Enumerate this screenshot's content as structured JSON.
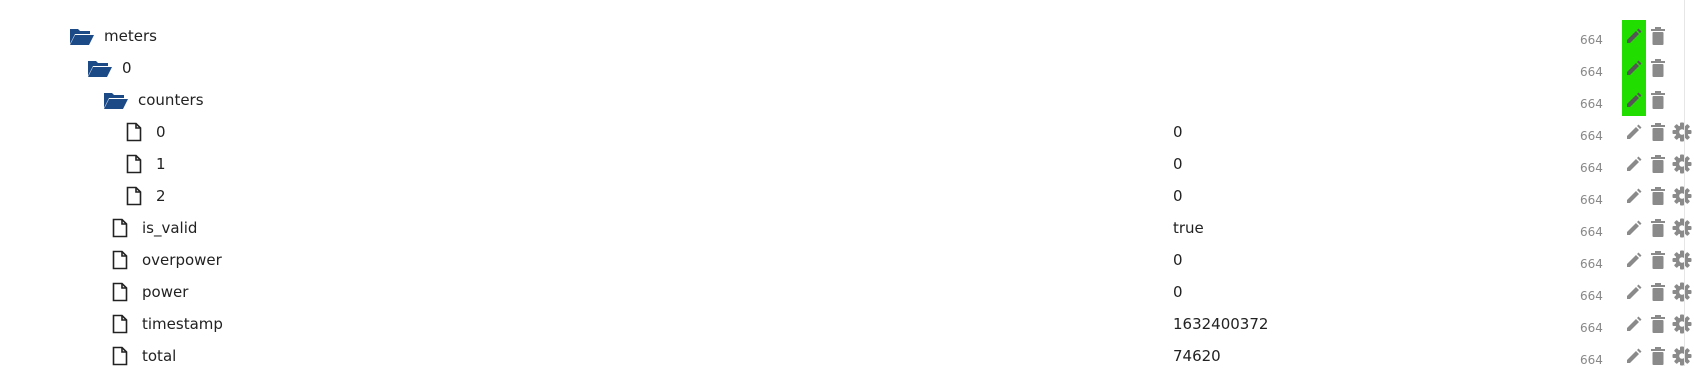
{
  "tree": {
    "rows": [
      {
        "name": "meters",
        "type": "folder",
        "value": "",
        "perm": "664",
        "edit_highlighted": true,
        "has_settings": false
      },
      {
        "name": "0",
        "type": "folder",
        "value": "",
        "perm": "664",
        "edit_highlighted": true,
        "has_settings": false
      },
      {
        "name": "counters",
        "type": "folder",
        "value": "",
        "perm": "664",
        "edit_highlighted": true,
        "has_settings": false
      },
      {
        "name": "0",
        "type": "file",
        "value": "0",
        "perm": "664",
        "edit_highlighted": false,
        "has_settings": true
      },
      {
        "name": "1",
        "type": "file",
        "value": "0",
        "perm": "664",
        "edit_highlighted": false,
        "has_settings": true
      },
      {
        "name": "2",
        "type": "file",
        "value": "0",
        "perm": "664",
        "edit_highlighted": false,
        "has_settings": true
      },
      {
        "name": "is_valid",
        "type": "file",
        "value": "true",
        "perm": "664",
        "edit_highlighted": false,
        "has_settings": true
      },
      {
        "name": "overpower",
        "type": "file",
        "value": "0",
        "perm": "664",
        "edit_highlighted": false,
        "has_settings": true
      },
      {
        "name": "power",
        "type": "file",
        "value": "0",
        "perm": "664",
        "edit_highlighted": false,
        "has_settings": true
      },
      {
        "name": "timestamp",
        "type": "file",
        "value": "1632400372",
        "perm": "664",
        "edit_highlighted": false,
        "has_settings": true
      },
      {
        "name": "total",
        "type": "file",
        "value": "74620",
        "perm": "664",
        "edit_highlighted": false,
        "has_settings": true
      }
    ]
  },
  "colors": {
    "folder_icon": "#1b4a87",
    "edit_highlight": "#22dd00",
    "action_icon": "#8a8a8a",
    "perm_text": "#888888"
  },
  "icons": {
    "folder": "folder-open-icon",
    "file": "file-icon",
    "edit": "pencil-icon",
    "delete": "trash-icon",
    "settings": "gear-icon"
  }
}
